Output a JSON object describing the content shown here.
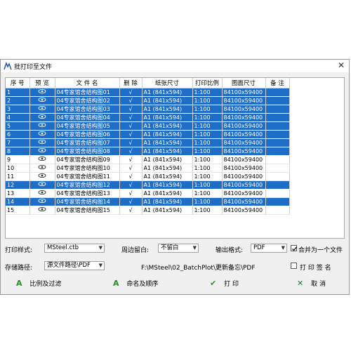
{
  "window": {
    "title": "批打印至文件",
    "close_glyph": "✕"
  },
  "table": {
    "headers": [
      "序 号",
      "预 览",
      "文 件 名",
      "删 除",
      "纸张尺寸",
      "打印比例",
      "图面尺寸",
      "备 注"
    ],
    "rows": [
      {
        "no": "1",
        "file": "04专家馆舍结构图01",
        "del": "√",
        "paper": "A1 (841x594)",
        "scale": "1:100",
        "size": "84100x59400",
        "selected": true
      },
      {
        "no": "2",
        "file": "04专家馆舍结构图02",
        "del": "√",
        "paper": "A1 (841x594)",
        "scale": "1:100",
        "size": "84100x59400",
        "selected": true
      },
      {
        "no": "3",
        "file": "04专家馆舍结构图03",
        "del": "√",
        "paper": "A1 (841x594)",
        "scale": "1:100",
        "size": "84100x59400",
        "selected": true
      },
      {
        "no": "4",
        "file": "04专家馆舍结构图04",
        "del": "√",
        "paper": "A1 (841x594)",
        "scale": "1:100",
        "size": "84100x59400",
        "selected": true
      },
      {
        "no": "5",
        "file": "04专家馆舍结构图05",
        "del": "√",
        "paper": "A1 (841x594)",
        "scale": "1:100",
        "size": "84100x59400",
        "selected": true
      },
      {
        "no": "6",
        "file": "04专家馆舍结构图06",
        "del": "√",
        "paper": "A1 (841x594)",
        "scale": "1:100",
        "size": "84100x59400",
        "selected": true
      },
      {
        "no": "7",
        "file": "04专家馆舍结构图07",
        "del": "√",
        "paper": "A1 (841x594)",
        "scale": "1:100",
        "size": "84100x59400",
        "selected": true
      },
      {
        "no": "8",
        "file": "04专家馆舍结构图08",
        "del": "√",
        "paper": "A1 (841x594)",
        "scale": "1:100",
        "size": "84100x59400",
        "selected": true
      },
      {
        "no": "9",
        "file": "04专家馆舍结构图09",
        "del": "√",
        "paper": "A1 (841x594)",
        "scale": "1:100",
        "size": "84100x59400",
        "selected": false
      },
      {
        "no": "10",
        "file": "04专家馆舍结构图10",
        "del": "√",
        "paper": "A1 (841x594)",
        "scale": "1:100",
        "size": "84100x59400",
        "selected": false
      },
      {
        "no": "11",
        "file": "04专家馆舍结构图11",
        "del": "√",
        "paper": "A1 (841x594)",
        "scale": "1:100",
        "size": "84100x59400",
        "selected": false
      },
      {
        "no": "12",
        "file": "04专家馆舍结构图12",
        "del": "√",
        "paper": "A1 (841x594)",
        "scale": "1:100",
        "size": "84100x59400",
        "selected": true
      },
      {
        "no": "13",
        "file": "04专家馆舍结构图13",
        "del": "√",
        "paper": "A1 (841x594)",
        "scale": "1:100",
        "size": "84100x59400",
        "selected": false
      },
      {
        "no": "14",
        "file": "04专家馆舍结构图14",
        "del": "√",
        "paper": "A1 (841x594)",
        "scale": "1:100",
        "size": "84100x59400",
        "selected": true
      },
      {
        "no": "15",
        "file": "04专家馆舍结构图15",
        "del": "√",
        "paper": "A1 (841x594)",
        "scale": "1:100",
        "size": "84100x59400",
        "selected": false
      }
    ]
  },
  "options": {
    "print_style_label": "打印样式:",
    "print_style_value": "MSteel.ctb",
    "margin_label": "周边留白:",
    "margin_value": "不留白",
    "format_label": "输出格式:",
    "format_value": "PDF",
    "merge_label": "合并为一个文件",
    "merge_checked": true,
    "path_label": "存储路径:",
    "path_value": "源文件路径\\PDF",
    "path_display": "F:\\MSteel\\02_BatchPlot\\更新备忘\\PDF",
    "sign_label": "打 印 签 名",
    "sign_checked": false
  },
  "buttons": {
    "filter": "比例及过滤",
    "naming": "命名及顺序",
    "print": "打 印",
    "cancel": "取 消"
  },
  "colors": {
    "selection": "#1e6ec8",
    "button_icon_green": "#2a8a2a"
  }
}
